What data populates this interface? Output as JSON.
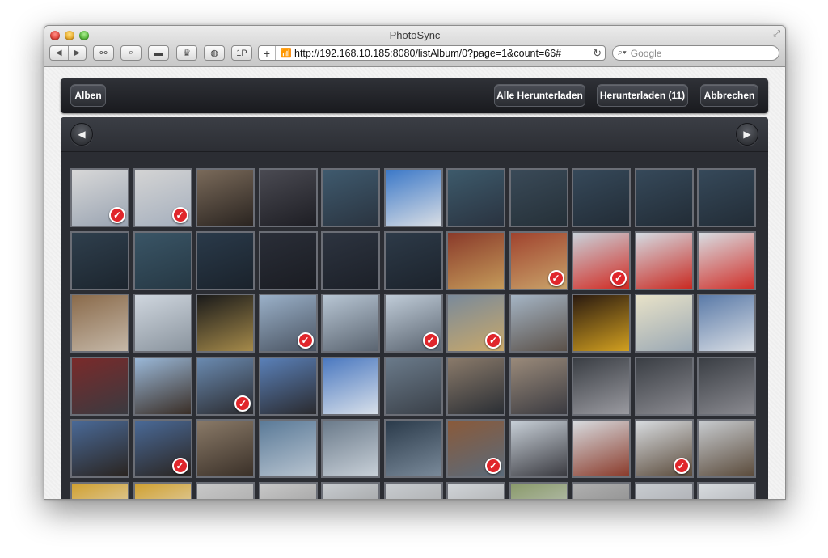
{
  "window": {
    "title": "PhotoSync"
  },
  "toolbar": {
    "back_icon": "back-arrow-icon",
    "forward_icon": "forward-arrow-icon",
    "buttons": [
      {
        "name": "reader-glasses-button",
        "glyph": "⚯"
      },
      {
        "name": "search-tool-button",
        "glyph": "⌕"
      },
      {
        "name": "tab-view-button",
        "glyph": "▬"
      },
      {
        "name": "crown-extension-button",
        "glyph": "♛"
      },
      {
        "name": "clip-extension-button",
        "glyph": "◍"
      },
      {
        "name": "onepassword-button",
        "glyph": "1P"
      }
    ],
    "url": "http://192.168.10.185:8080/listAlbum/0?page=1&count=66#",
    "search_placeholder": "Google"
  },
  "app": {
    "albums_button": "Alben",
    "download_all_button": "Alle Herunterladen",
    "download_button": "Herunterladen (11)",
    "cancel_button": "Abbrechen",
    "prev_glyph": "◀",
    "next_glyph": "▶"
  },
  "colors": {
    "check": "#e0262b",
    "bar": "#1f2025",
    "panel": "#2b2d33"
  },
  "thumbnails": [
    {
      "c1": "#d8d8d8",
      "c2": "#9aa4b2",
      "checked": true
    },
    {
      "c1": "#d4d4d4",
      "c2": "#a5afbd",
      "checked": true
    },
    {
      "c1": "#7a6a5a",
      "c2": "#2a2420",
      "checked": false
    },
    {
      "c1": "#4a4a52",
      "c2": "#1e1e24",
      "checked": false
    },
    {
      "c1": "#3f5a6e",
      "c2": "#2a3440",
      "checked": false
    },
    {
      "c1": "#3b78c8",
      "c2": "#d8dde4",
      "checked": false
    },
    {
      "c1": "#3d5a6b",
      "c2": "#2a3340",
      "checked": false
    },
    {
      "c1": "#3a4a58",
      "c2": "#253038",
      "checked": false
    },
    {
      "c1": "#36495a",
      "c2": "#222c36",
      "checked": false
    },
    {
      "c1": "#36495a",
      "c2": "#222c36",
      "checked": false
    },
    {
      "c1": "#36495a",
      "c2": "#222c36",
      "checked": false
    },
    {
      "c1": "#2f3f4d",
      "c2": "#1c252e",
      "checked": false
    },
    {
      "c1": "#3a5566",
      "c2": "#263844",
      "checked": false
    },
    {
      "c1": "#2a3a4a",
      "c2": "#1a222b",
      "checked": false
    },
    {
      "c1": "#2a2e38",
      "c2": "#1a1c22",
      "checked": false
    },
    {
      "c1": "#2d3440",
      "c2": "#1c2028",
      "checked": false
    },
    {
      "c1": "#2d3a48",
      "c2": "#1c232c",
      "checked": false
    },
    {
      "c1": "#8a3a2a",
      "c2": "#c49a5a",
      "checked": false
    },
    {
      "c1": "#a0432e",
      "c2": "#c9a36a",
      "checked": true
    },
    {
      "c1": "#c9d2da",
      "c2": "#d12a22",
      "checked": true
    },
    {
      "c1": "#d4dbe2",
      "c2": "#c92a22",
      "checked": false
    },
    {
      "c1": "#d8dde2",
      "c2": "#d0302a",
      "checked": false
    },
    {
      "c1": "#8a6a4a",
      "c2": "#c5b8a8",
      "checked": false
    },
    {
      "c1": "#cfd6de",
      "c2": "#8a949e",
      "checked": false
    },
    {
      "c1": "#1a1a1a",
      "c2": "#a58a4a",
      "checked": false
    },
    {
      "c1": "#9ab0c8",
      "c2": "#4a5462",
      "checked": true
    },
    {
      "c1": "#b8c6d4",
      "c2": "#5a6470",
      "checked": false
    },
    {
      "c1": "#c0ccd8",
      "c2": "#5a6470",
      "checked": true
    },
    {
      "c1": "#7a8a9a",
      "c2": "#c8a86a",
      "checked": true
    },
    {
      "c1": "#a5b5c5",
      "c2": "#5a5048",
      "checked": false
    },
    {
      "c1": "#2a1a10",
      "c2": "#d2a020",
      "checked": false
    },
    {
      "c1": "#e8e2c8",
      "c2": "#9aa8b4",
      "checked": false
    },
    {
      "c1": "#5a7aa8",
      "c2": "#d8dde4",
      "checked": false
    },
    {
      "c1": "#7a2a2a",
      "c2": "#3a3a40",
      "checked": false
    },
    {
      "c1": "#9ab8d8",
      "c2": "#3a2e26",
      "checked": false
    },
    {
      "c1": "#6a8ab0",
      "c2": "#2a2a2e",
      "checked": true
    },
    {
      "c1": "#5a80b8",
      "c2": "#2a2a2e",
      "checked": false
    },
    {
      "c1": "#4a78c0",
      "c2": "#d8e0ea",
      "checked": false
    },
    {
      "c1": "#6a7a8a",
      "c2": "#3a4048",
      "checked": false
    },
    {
      "c1": "#8a7a6a",
      "c2": "#2a2e34",
      "checked": false
    },
    {
      "c1": "#9a8a7a",
      "c2": "#3a3a40",
      "checked": false
    },
    {
      "c1": "#3a3e44",
      "c2": "#9a9aa0",
      "checked": false
    },
    {
      "c1": "#3a3e44",
      "c2": "#8a8a90",
      "checked": false
    },
    {
      "c1": "#3a3e44",
      "c2": "#8a8a90",
      "checked": false
    },
    {
      "c1": "#4a6a98",
      "c2": "#2a2420",
      "checked": false
    },
    {
      "c1": "#4a6a98",
      "c2": "#2a2420",
      "checked": true
    },
    {
      "c1": "#8a7a68",
      "c2": "#3a3028",
      "checked": false
    },
    {
      "c1": "#5a7a98",
      "c2": "#b8c4d0",
      "checked": false
    },
    {
      "c1": "#6a7a8a",
      "c2": "#c8d0d8",
      "checked": false
    },
    {
      "c1": "#2a3a4a",
      "c2": "#7a8a9a",
      "checked": false
    },
    {
      "c1": "#8a5a3a",
      "c2": "#5a6a7a",
      "checked": true
    },
    {
      "c1": "#c8d0d8",
      "c2": "#3a3a40",
      "checked": false
    },
    {
      "c1": "#d8dce0",
      "c2": "#8a3a2a",
      "checked": false
    },
    {
      "c1": "#d8dce0",
      "c2": "#5a4a3a",
      "checked": true
    },
    {
      "c1": "#c8ccd0",
      "c2": "#5a4a3a",
      "checked": false
    },
    {
      "c1": "#d0a030",
      "c2": "#e8e8e8",
      "checked": false
    },
    {
      "c1": "#d0a030",
      "c2": "#e8e8e8",
      "checked": false
    },
    {
      "c1": "#c8c8c8",
      "c2": "#9a9a9a",
      "checked": false
    },
    {
      "c1": "#c8c8c8",
      "c2": "#8a8a8a",
      "checked": false
    },
    {
      "c1": "#c8ccd0",
      "c2": "#8a8a8a",
      "checked": false
    },
    {
      "c1": "#c8ccd0",
      "c2": "#9a9a9a",
      "checked": false
    },
    {
      "c1": "#d0d4d8",
      "c2": "#9a9a9a",
      "checked": false
    },
    {
      "c1": "#8a9a6a",
      "c2": "#d0d4d8",
      "checked": false
    },
    {
      "c1": "#b0b0b0",
      "c2": "#7a7a7a",
      "checked": false
    },
    {
      "c1": "#c8ccd0",
      "c2": "#9a9aa0",
      "checked": false
    },
    {
      "c1": "#d8dcdf",
      "c2": "#9a9aa0",
      "checked": false
    }
  ]
}
